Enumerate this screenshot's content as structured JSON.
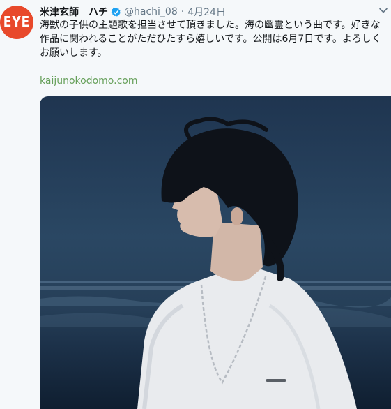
{
  "avatar": {
    "text": "EYE",
    "color": "#e8492b"
  },
  "tweet": {
    "author_name": "米津玄師　ハチ",
    "handle": "@hachi_08",
    "separator": "·",
    "date": "4月24日",
    "text": "海獣の子供の主題歌を担当させて頂きました。海の幽霊という曲です。好きな作品に関われることがただひたすら嬉しいです。公開は6月7日です。よろしくお願いします。",
    "link": "kaijunokodomo.com"
  },
  "icons": {
    "verified": "verified-badge-icon",
    "caret": "chevron-down-icon"
  },
  "colors": {
    "background": "#f5f8fa",
    "link": "#66a05a",
    "verified": "#1da1f2",
    "secondary_text": "#657786"
  }
}
